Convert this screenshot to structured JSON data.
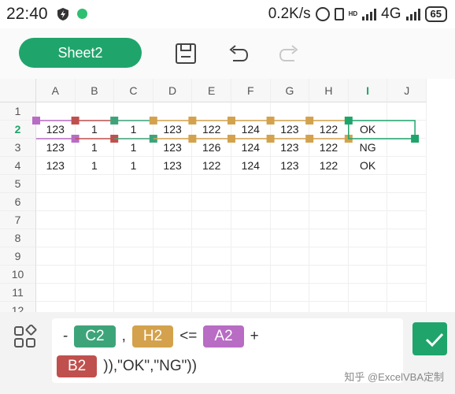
{
  "status_bar": {
    "time": "22:40",
    "network_speed": "0.2K/s",
    "hd_label": "HD",
    "network_type": "4G",
    "battery": "65"
  },
  "toolbar": {
    "sheet_tab": "Sheet2",
    "icons": [
      "save-icon",
      "undo-icon",
      "redo-icon"
    ]
  },
  "sheet": {
    "columns": [
      "A",
      "B",
      "C",
      "D",
      "E",
      "F",
      "G",
      "H",
      "I",
      "J"
    ],
    "rows": [
      "1",
      "2",
      "3",
      "4",
      "5",
      "6",
      "7",
      "8",
      "9",
      "10",
      "11",
      "12"
    ],
    "active_row": "2",
    "active_column": "I",
    "data": {
      "r2": [
        "123",
        "1",
        "1",
        "123",
        "122",
        "124",
        "123",
        "122",
        "OK"
      ],
      "r3": [
        "123",
        "1",
        "1",
        "123",
        "126",
        "124",
        "123",
        "122",
        "NG"
      ],
      "r4": [
        "123",
        "1",
        "1",
        "123",
        "122",
        "124",
        "123",
        "122",
        "OK"
      ]
    },
    "colors": {
      "accent": "#1fa56b",
      "ref_purple": "#b86cc4",
      "ref_red": "#c0504d",
      "ref_green": "#3da47a",
      "ref_orange": "#d4a24c"
    }
  },
  "formula": {
    "tokens": [
      {
        "text": "-"
      },
      {
        "chip": "C2",
        "color": "#3da47a"
      },
      {
        "text": ","
      },
      {
        "chip": "H2",
        "color": "#d4a24c"
      },
      {
        "text": "<="
      },
      {
        "chip": "A2",
        "color": "#b86cc4"
      },
      {
        "text": "+"
      }
    ],
    "tokens_line2": [
      {
        "chip": "B2",
        "color": "#c0504d"
      },
      {
        "text": ")),\"OK\",\"NG\"))"
      }
    ]
  },
  "watermark": "知乎 @ExcelVBA定制"
}
